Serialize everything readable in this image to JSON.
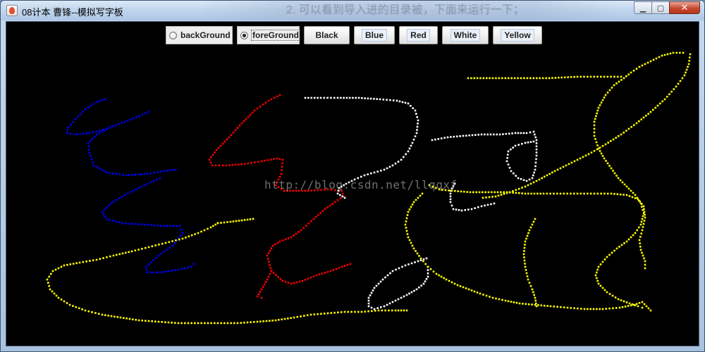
{
  "window": {
    "title": "08计本 曹锋--模拟写字板",
    "background_title": "2. 可以看到导入进的目录被，下面来运行一下；",
    "controls": {
      "minimize": "▁",
      "maximize": "▢",
      "close": "✕"
    }
  },
  "toolbar": {
    "radios": [
      {
        "label": "backGround",
        "selected": false
      },
      {
        "label": "foreGround",
        "selected": true
      }
    ],
    "buttons": [
      {
        "label": "Black"
      },
      {
        "label": "Blue"
      },
      {
        "label": "Red"
      },
      {
        "label": "White"
      },
      {
        "label": "Yellow"
      }
    ]
  },
  "canvas": {
    "background_color": "#000000",
    "watermark": "http://blog.csdn.net/llqqxf",
    "stroke_colors": {
      "blue": "#0000ff",
      "red": "#ff0000",
      "white": "#ffffff",
      "yellow": "#ffff00"
    }
  }
}
